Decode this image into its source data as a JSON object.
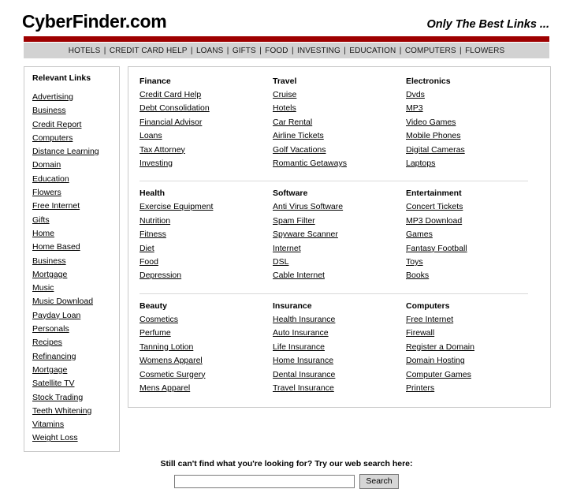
{
  "header": {
    "brand": "CyberFinder.com",
    "tagline": "Only The Best Links ...",
    "accent_color": "#9e0000",
    "navbar_color": "#d2d2d2"
  },
  "nav": {
    "separator": "|",
    "items": [
      {
        "label": "HOTELS"
      },
      {
        "label": "CREDIT CARD HELP"
      },
      {
        "label": "LOANS"
      },
      {
        "label": "GIFTS"
      },
      {
        "label": "FOOD"
      },
      {
        "label": "INVESTING"
      },
      {
        "label": "EDUCATION"
      },
      {
        "label": "COMPUTERS"
      },
      {
        "label": "FLOWERS"
      }
    ]
  },
  "sidebar": {
    "title": "Relevant Links",
    "items": [
      {
        "label": "Advertising"
      },
      {
        "label": "Business"
      },
      {
        "label": "Credit Report"
      },
      {
        "label": "Computers"
      },
      {
        "label": "Distance Learning"
      },
      {
        "label": "Domain"
      },
      {
        "label": "Education"
      },
      {
        "label": "Flowers"
      },
      {
        "label": "Free Internet"
      },
      {
        "label": "Gifts"
      },
      {
        "label": "Home"
      },
      {
        "label": "Home Based Business"
      },
      {
        "label": "Mortgage"
      },
      {
        "label": "Music"
      },
      {
        "label": "Music Download"
      },
      {
        "label": "Payday Loan"
      },
      {
        "label": "Personals"
      },
      {
        "label": "Recipes"
      },
      {
        "label": "Refinancing Mortgage"
      },
      {
        "label": "Satellite TV"
      },
      {
        "label": "Stock Trading"
      },
      {
        "label": "Teeth Whitening"
      },
      {
        "label": "Vitamins"
      },
      {
        "label": "Weight Loss"
      }
    ]
  },
  "main": {
    "rows": [
      {
        "columns": [
          {
            "title": "Finance",
            "links": [
              "Credit Card Help",
              "Debt Consolidation",
              "Financial Advisor",
              "Loans",
              "Tax Attorney",
              "Investing"
            ]
          },
          {
            "title": "Travel",
            "links": [
              "Cruise",
              "Hotels",
              "Car Rental",
              "Airline Tickets",
              "Golf Vacations",
              "Romantic Getaways"
            ]
          },
          {
            "title": "Electronics",
            "links": [
              "Dvds",
              "MP3",
              "Video Games",
              "Mobile Phones",
              "Digital Cameras",
              "Laptops"
            ]
          }
        ]
      },
      {
        "columns": [
          {
            "title": "Health",
            "links": [
              "Exercise Equipment",
              "Nutrition",
              "Fitness",
              "Diet",
              "Food",
              "Depression"
            ]
          },
          {
            "title": "Software",
            "links": [
              "Anti Virus Software",
              "Spam Filter",
              "Spyware Scanner",
              "Internet",
              "DSL",
              "Cable Internet"
            ]
          },
          {
            "title": "Entertainment",
            "links": [
              "Concert Tickets",
              "MP3 Download",
              "Games",
              "Fantasy Football",
              "Toys",
              "Books"
            ]
          }
        ]
      },
      {
        "columns": [
          {
            "title": "Beauty",
            "links": [
              "Cosmetics",
              "Perfume",
              "Tanning Lotion",
              "Womens Apparel",
              "Cosmetic Surgery",
              "Mens Apparel"
            ]
          },
          {
            "title": "Insurance",
            "links": [
              "Health Insurance",
              "Auto Insurance",
              "Life Insurance",
              "Home Insurance",
              "Dental Insurance",
              "Travel Insurance"
            ]
          },
          {
            "title": "Computers",
            "links": [
              "Free Internet",
              "Firewall",
              "Register a Domain",
              "Domain Hosting",
              "Computer Games",
              "Printers"
            ]
          }
        ]
      }
    ]
  },
  "search": {
    "prompt": "Still can't find what you're looking for? Try our web search here:",
    "input_value": "",
    "input_placeholder": "",
    "button_label": "Search"
  }
}
